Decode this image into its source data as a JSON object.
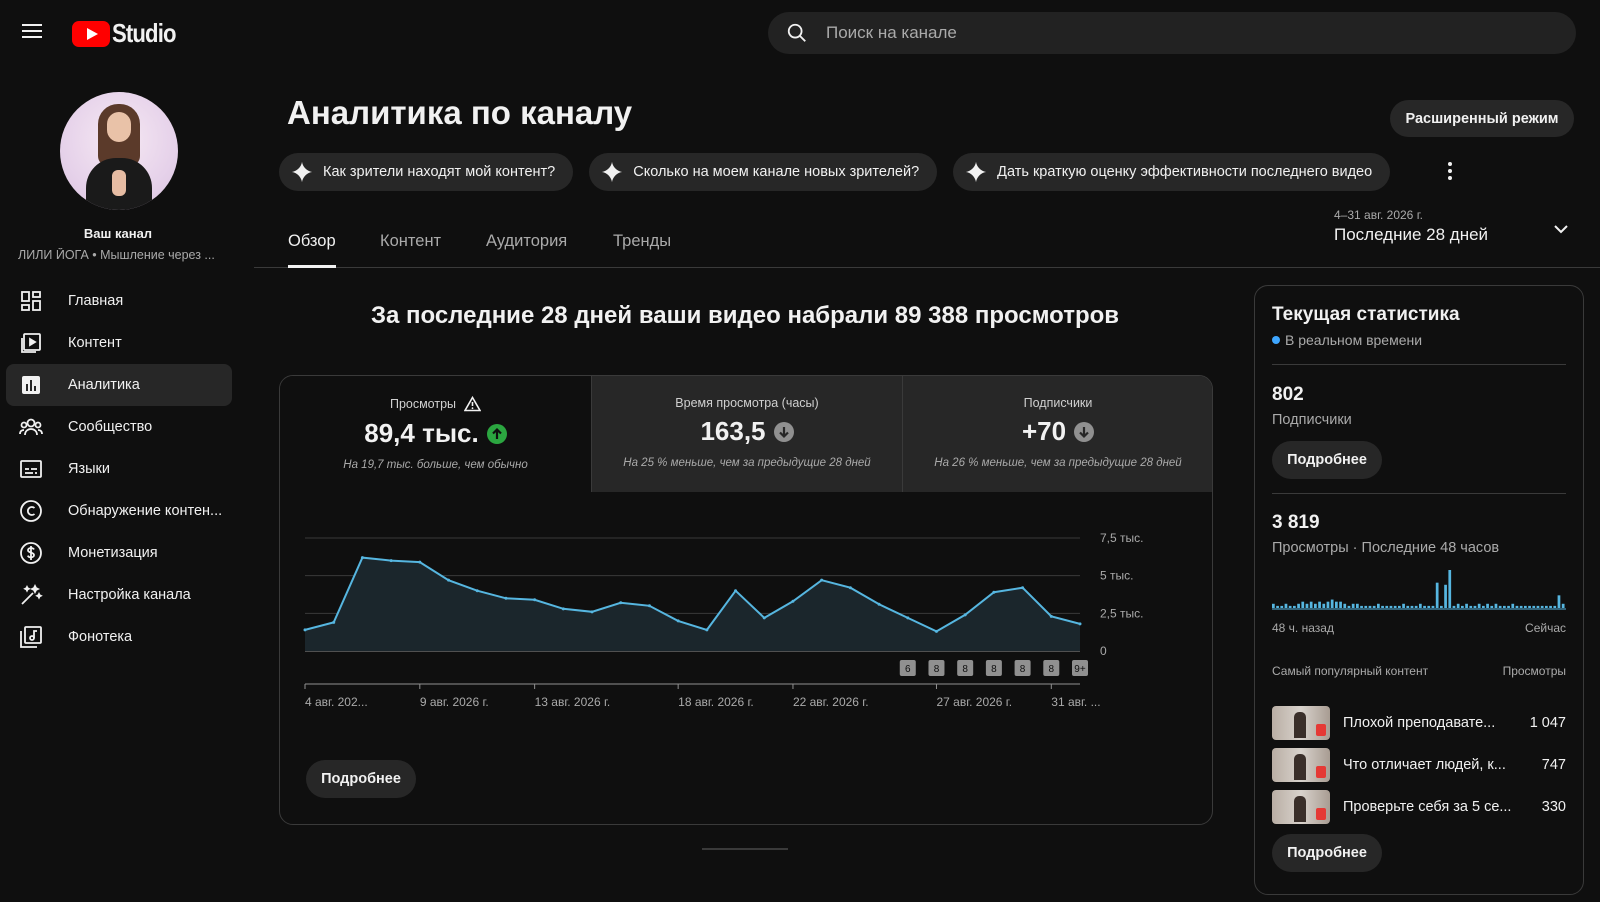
{
  "app": {
    "logo_text": "Studio"
  },
  "search": {
    "placeholder": "Поиск на канале"
  },
  "sidebar": {
    "channel_label": "Ваш канал",
    "channel_name": "ЛИЛИ ЙОГА • Мышление через ...",
    "items": [
      {
        "label": "Главная",
        "icon": "dashboard-icon"
      },
      {
        "label": "Контент",
        "icon": "content-icon"
      },
      {
        "label": "Аналитика",
        "icon": "analytics-icon",
        "active": true
      },
      {
        "label": "Сообщество",
        "icon": "community-icon"
      },
      {
        "label": "Языки",
        "icon": "subtitles-icon"
      },
      {
        "label": "Обнаружение контен...",
        "icon": "copyright-icon"
      },
      {
        "label": "Монетизация",
        "icon": "monetization-icon"
      },
      {
        "label": "Настройка канала",
        "icon": "customization-icon"
      },
      {
        "label": "Фонотека",
        "icon": "audio-library-icon"
      }
    ]
  },
  "header": {
    "title": "Аналитика по каналу",
    "advanced_button": "Расширенный режим",
    "chips": [
      "Как зрители находят мой контент?",
      "Сколько на моем канале новых зрителей?",
      "Дать краткую оценку эффективности последнего видео"
    ]
  },
  "tabs": [
    "Обзор",
    "Контент",
    "Аудитория",
    "Тренды"
  ],
  "date_range": {
    "sub": "4–31 авг. 2026 г.",
    "main": "Последние 28 дней"
  },
  "headline": "За последние 28 дней ваши видео набрали 89 388 просмотров",
  "metrics": [
    {
      "label": "Просмотры",
      "value": "89,4 тыс.",
      "trend": "up",
      "note": "На 19,7 тыс. больше, чем обычно"
    },
    {
      "label": "Время просмотра (часы)",
      "value": "163,5",
      "trend": "down",
      "note": "На 25 % меньше, чем за предыдущие 28 дней"
    },
    {
      "label": "Подписчики",
      "value": "+70",
      "trend": "down",
      "note": "На 26 % меньше, чем за предыдущие 28 дней"
    }
  ],
  "card_button": "Подробнее",
  "chart_data": {
    "type": "area",
    "y_ticks": [
      "7,5 тыс.",
      "5 тыс.",
      "2,5 тыс.",
      "0"
    ],
    "ylim": [
      0,
      7500
    ],
    "x_labels": [
      "4 авг. 202...",
      "9 авг. 2026 г.",
      "13 авг. 2026 г.",
      "18 авг. 2026 г.",
      "22 авг. 2026 г.",
      "27 авг. 2026 г.",
      "31 авг. ..."
    ],
    "values": [
      1400,
      1900,
      6200,
      6000,
      5900,
      4700,
      4000,
      3500,
      3400,
      2800,
      2600,
      3200,
      3000,
      2000,
      1400,
      4000,
      2200,
      3300,
      4700,
      4200,
      3100,
      2200,
      1300,
      2400,
      3900,
      4200,
      2300,
      1800
    ],
    "markers": [
      "6",
      "8",
      "8",
      "8",
      "8",
      "8",
      "9+"
    ],
    "line_color": "#56b6e0",
    "fill_color": "#1b262c"
  },
  "realtime": {
    "title": "Текущая статистика",
    "live": "В реальном времени",
    "subs_value": "802",
    "subs_label": "Подписчики",
    "subs_button": "Подробнее",
    "views_value": "3 819",
    "views_label": "Просмотры · Последние 48 часов",
    "axis_left": "48 ч. назад",
    "axis_right": "Сейчас",
    "bars": [
      2,
      1,
      1,
      2,
      1,
      1,
      2,
      3,
      2,
      3,
      2,
      3,
      2,
      3,
      4,
      3,
      3,
      2,
      1,
      2,
      2,
      1,
      1,
      1,
      1,
      2,
      1,
      1,
      1,
      1,
      1,
      2,
      1,
      1,
      1,
      2,
      1,
      1,
      1,
      12,
      1,
      11,
      18,
      1,
      2,
      1,
      2,
      1,
      1,
      2,
      1,
      2,
      1,
      2,
      1,
      1,
      1,
      2,
      1,
      1,
      1,
      1,
      1,
      1,
      1,
      1,
      1,
      1,
      6,
      2
    ],
    "top_header": "Самый популярный контент",
    "top_header_right": "Просмотры",
    "top": [
      {
        "title": "Плохой преподавате...",
        "views": "1 047"
      },
      {
        "title": "Что отличает людей, к...",
        "views": "747"
      },
      {
        "title": "Проверьте себя за 5 се...",
        "views": "330"
      }
    ],
    "top_button": "Подробнее"
  }
}
